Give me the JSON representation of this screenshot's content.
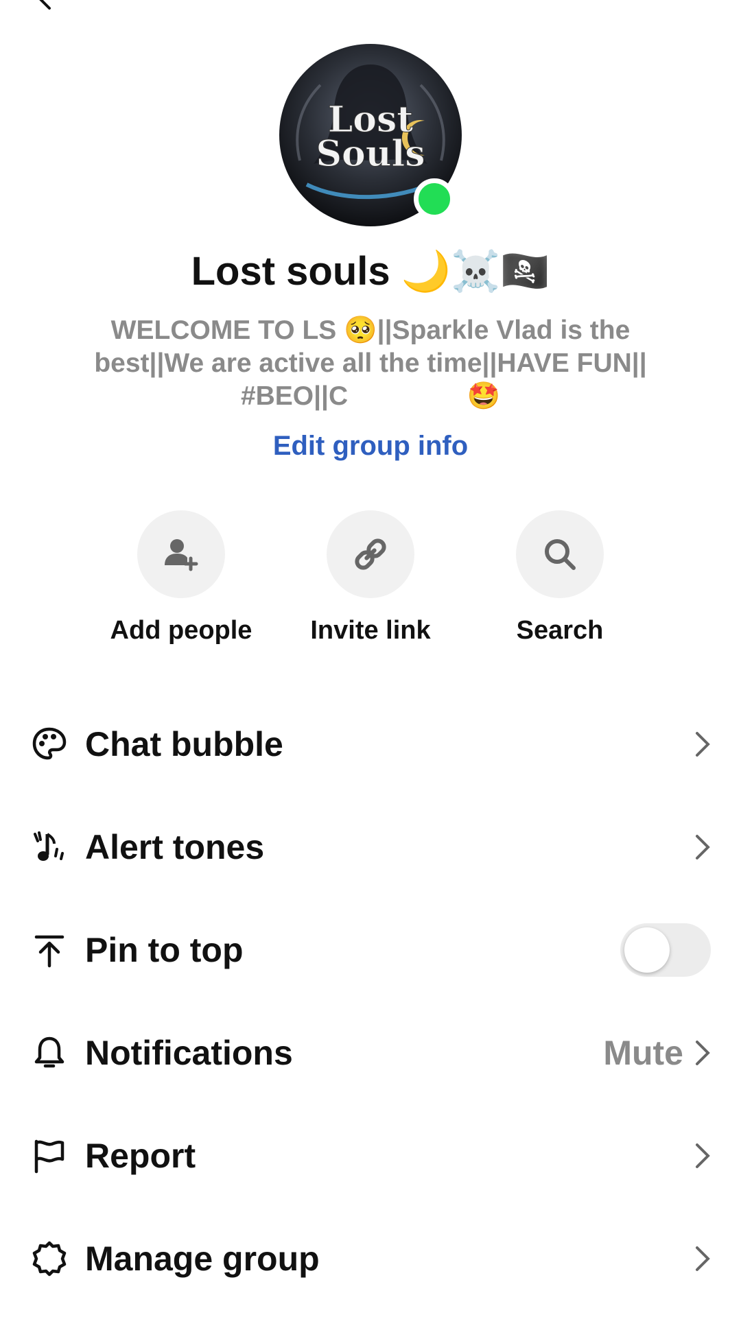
{
  "header": {
    "back_icon": "chevron-left-icon"
  },
  "group": {
    "avatar_text_line1": "Lost",
    "avatar_text_line2": "Souls",
    "online_color": "#22dd55",
    "name": "Lost souls 🌙☠️🏴‍☠️",
    "description_line1": "WELCOME TO LS 🥺||Sparkle Vlad is the",
    "description_line2": "best||We are active all the time||HAVE FUN||",
    "description_line3": "#BEO||C                🤩",
    "edit_label": "Edit group info"
  },
  "actions": [
    {
      "label": "Add people",
      "icon": "add-person-icon"
    },
    {
      "label": "Invite link",
      "icon": "link-icon"
    },
    {
      "label": "Search",
      "icon": "search-icon"
    }
  ],
  "settings": {
    "chat_bubble": {
      "label": "Chat bubble",
      "icon": "palette-icon"
    },
    "alert_tones": {
      "label": "Alert tones",
      "icon": "music-note-icon"
    },
    "pin_to_top": {
      "label": "Pin to top",
      "icon": "pin-top-icon",
      "enabled": false
    },
    "notifications": {
      "label": "Notifications",
      "icon": "bell-icon",
      "value": "Mute"
    },
    "report": {
      "label": "Report",
      "icon": "flag-icon"
    },
    "manage_group": {
      "label": "Manage group",
      "icon": "gear-icon"
    }
  },
  "colors": {
    "accent": "#2f5fbf",
    "muted_text": "#8a8a8a"
  }
}
